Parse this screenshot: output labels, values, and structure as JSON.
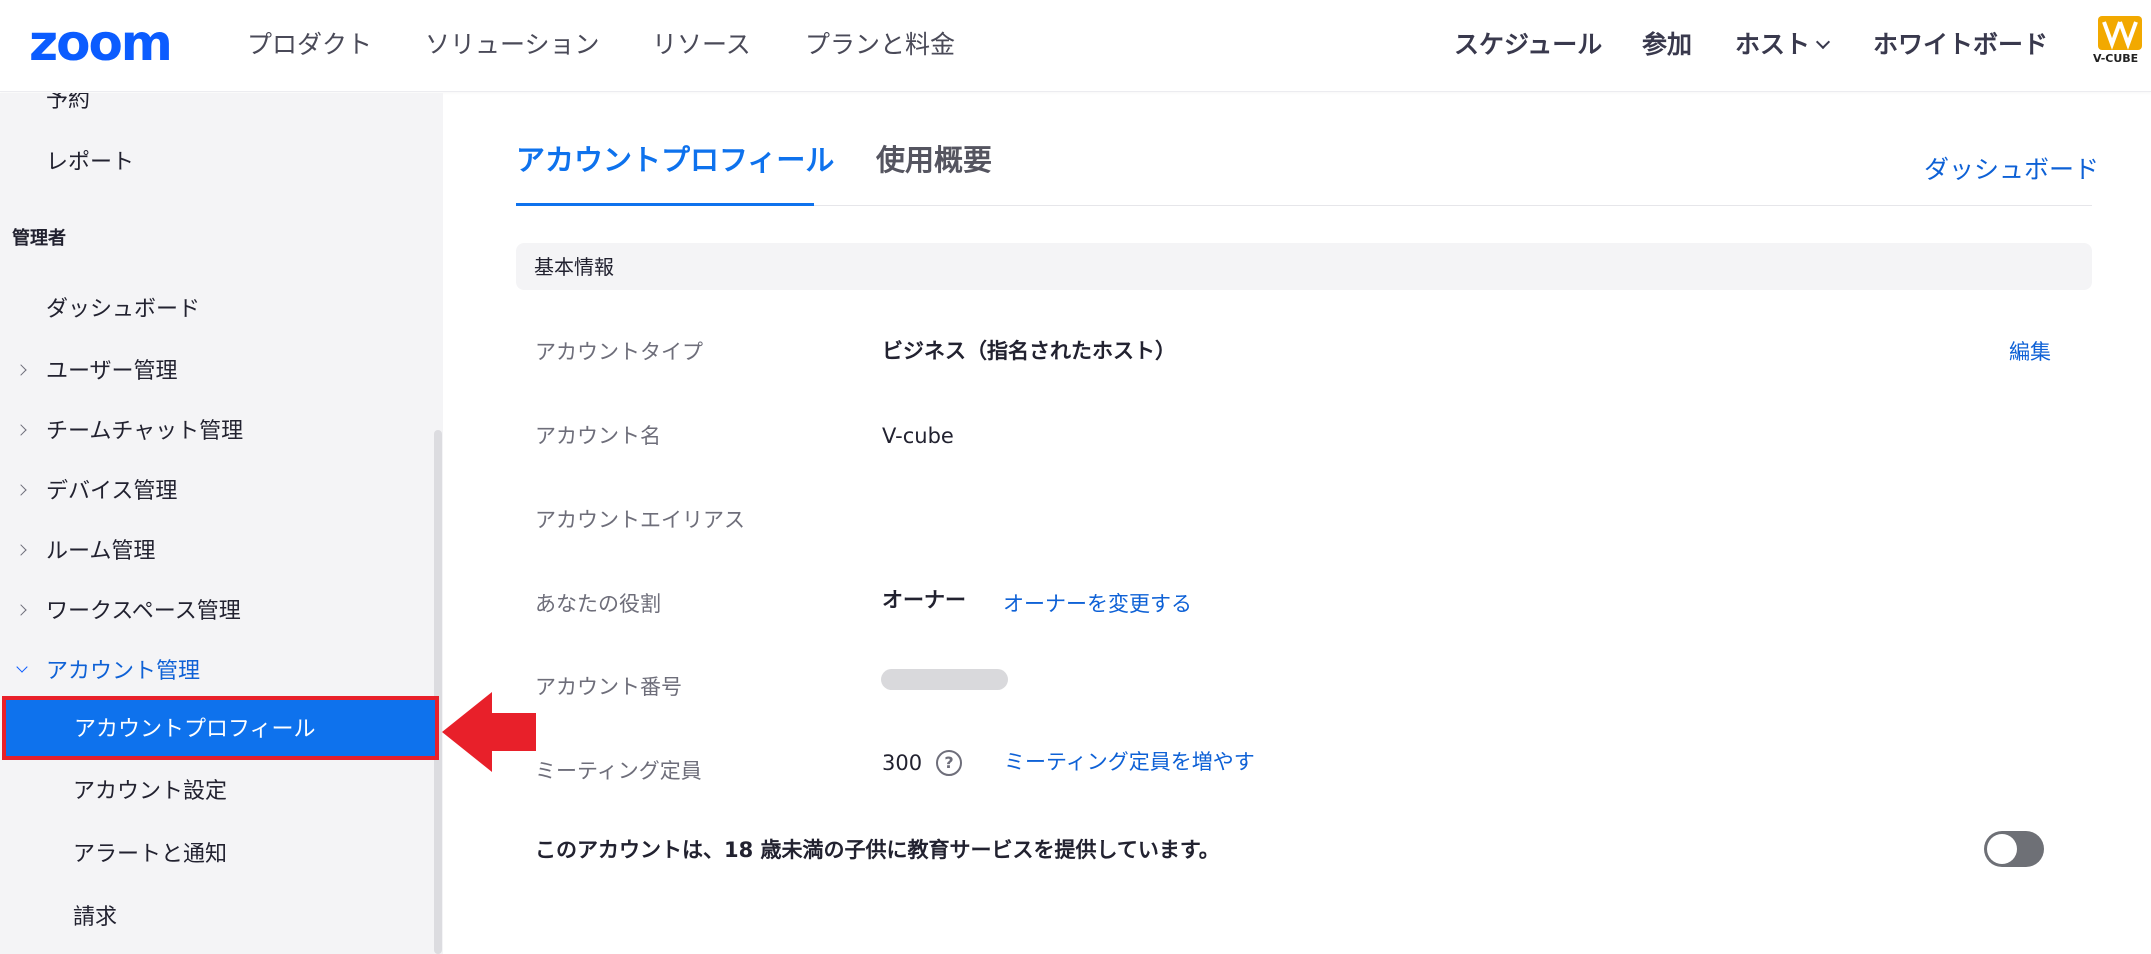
{
  "topnav": {
    "logo": "zoom",
    "left_links": [
      "プロダクト",
      "ソリューション",
      "リソース",
      "プランと料金"
    ],
    "right_links": {
      "schedule": "スケジュール",
      "join": "参加",
      "host": "ホスト",
      "whiteboard": "ホワイトボード"
    },
    "brand_badge": "V-CUBE",
    "accent": "#0b5cff"
  },
  "sidebar": {
    "items_top": [
      "予約",
      "レポート"
    ],
    "section_admin": "管理者",
    "dashboard": "ダッシュボード",
    "groups": [
      "ユーザー管理",
      "チームチャット管理",
      "デバイス管理",
      "ルーム管理",
      "ワークスペース管理"
    ],
    "account_group": "アカウント管理",
    "account_items": [
      "アカウントプロフィール",
      "アカウント設定",
      "アラートと通知",
      "請求"
    ],
    "active_item": "アカウントプロフィール",
    "active_color": "#0e72ed",
    "highlight_border": "#e8202a"
  },
  "main": {
    "tabs": [
      "アカウントプロフィール",
      "使用概要"
    ],
    "dashboard_link": "ダッシュボード",
    "section_title": "基本情報",
    "rows": {
      "account_type": {
        "label": "アカウントタイプ",
        "value": "ビジネス（指名されたホスト）",
        "action": "編集"
      },
      "account_name": {
        "label": "アカウント名",
        "value": "V-cube"
      },
      "account_alias": {
        "label": "アカウントエイリアス",
        "value": ""
      },
      "role": {
        "label": "あなたの役割",
        "value": "オーナー",
        "action": "オーナーを変更する"
      },
      "account_number": {
        "label": "アカウント番号",
        "value": ""
      },
      "capacity": {
        "label": "ミーティング定員",
        "value": "300",
        "action": "ミーティング定員を増やす",
        "help_icon": "?"
      }
    },
    "education_notice": "このアカウントは、18 歳未満の子供に教育サービスを提供しています。",
    "education_toggle": false
  }
}
